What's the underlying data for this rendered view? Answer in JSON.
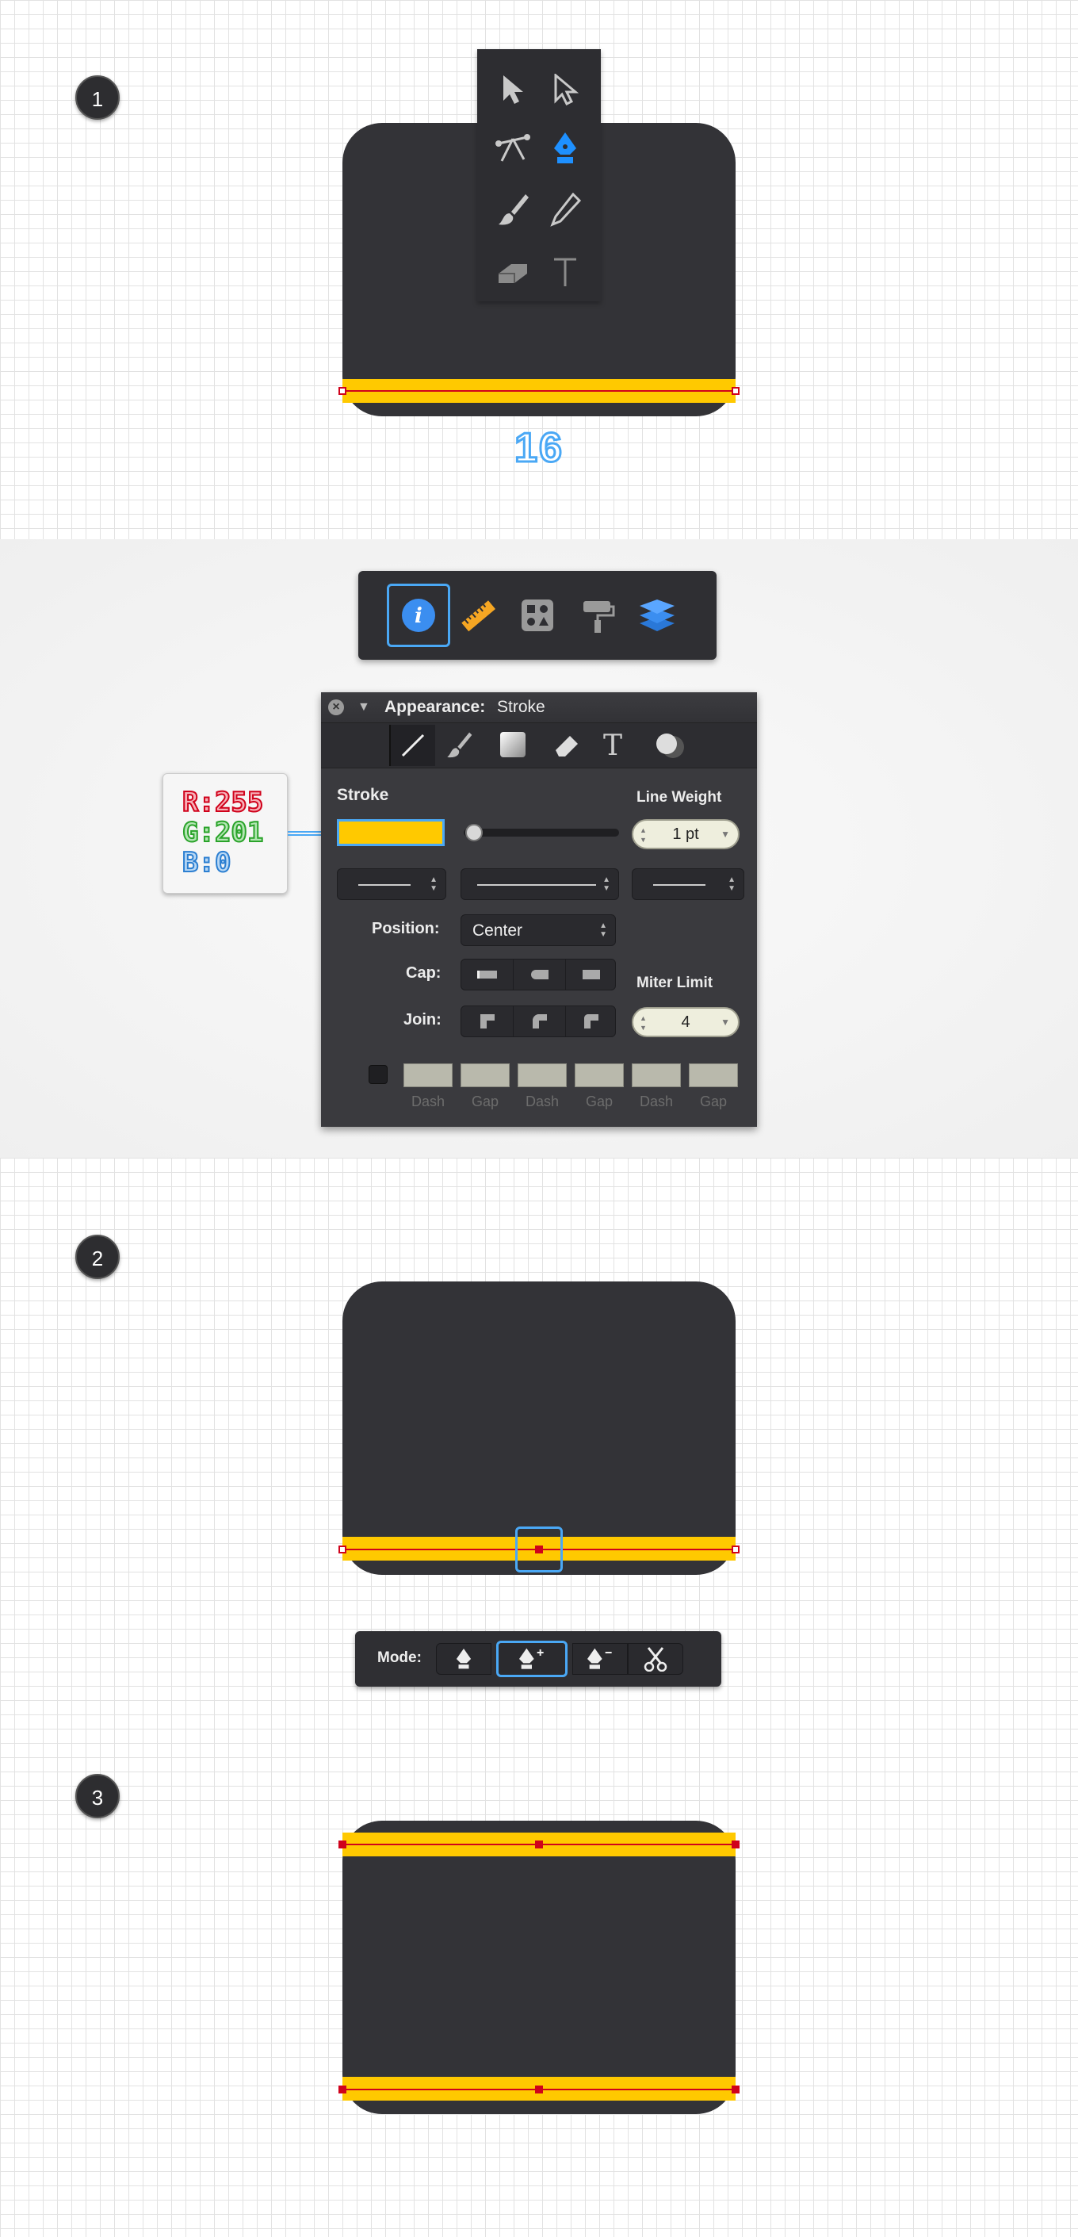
{
  "steps": [
    "1",
    "2",
    "3"
  ],
  "colors": {
    "icon_body": "#333337",
    "stroke_yellow": "#FFC900",
    "path_red": "#d0021b",
    "selection_blue": "#4aa8f5"
  },
  "step1": {
    "number_label": "16",
    "tools": [
      "selection-arrow-icon",
      "direct-selection-icon",
      "bezigon-icon",
      "pen-icon",
      "brush-icon",
      "pencil-icon",
      "eraser-icon",
      "text-icon"
    ],
    "active_tool": "pen-icon"
  },
  "inspector_tabs": [
    "info-icon",
    "ruler-icon",
    "shapes-icon",
    "paint-roller-icon",
    "layers-icon"
  ],
  "active_inspector_tab": "info-icon",
  "appearance_panel": {
    "title_bold": "Appearance:",
    "title_value": "Stroke",
    "tool_icons": [
      "line-icon",
      "brush-icon",
      "fill-icon",
      "eraser-icon",
      "text-icon",
      "shadow-icon"
    ],
    "stroke_label": "Stroke",
    "stroke_color": "#FFC900",
    "line_weight_label": "Line Weight",
    "line_weight_value": "1 pt",
    "position_label": "Position:",
    "position_value": "Center",
    "cap_label": "Cap:",
    "join_label": "Join:",
    "miter_label": "Miter Limit",
    "miter_value": "4",
    "dash_labels": [
      "Dash",
      "Gap",
      "Dash",
      "Gap",
      "Dash",
      "Gap"
    ]
  },
  "rgb_callout": {
    "r": "R:255",
    "g": "G:201",
    "b": "B:0"
  },
  "mode_bar": {
    "label": "Mode:",
    "modes": [
      "pen-icon",
      "add-anchor-icon",
      "remove-anchor-icon",
      "scissors-icon"
    ],
    "active_mode": "add-anchor-icon"
  }
}
